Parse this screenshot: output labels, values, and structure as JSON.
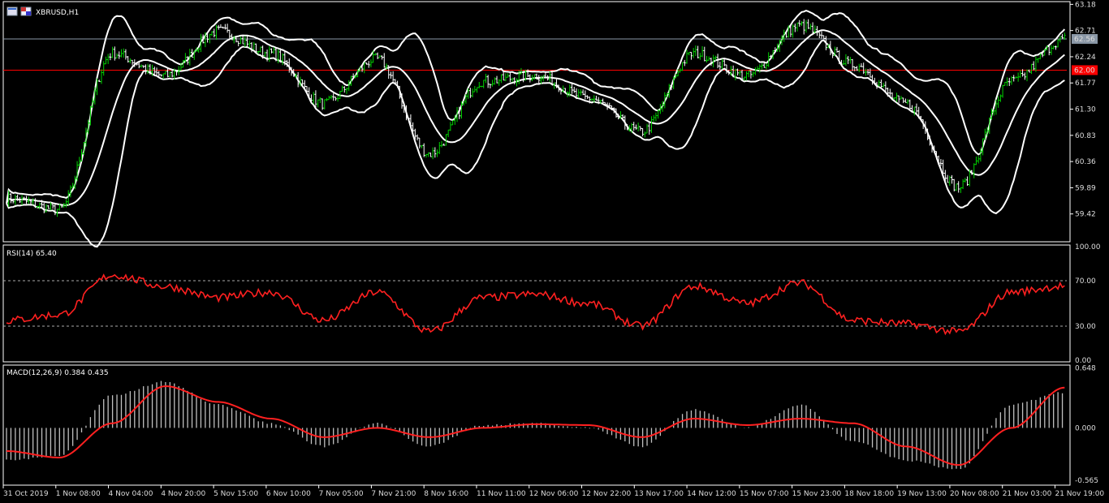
{
  "window": {
    "symbol_label": "XBRUSD,H1",
    "icon_names": [
      "chart-window-icon",
      "symbol-flag-icon"
    ]
  },
  "colors": {
    "background": "#000000",
    "bull_candle": "#00d000",
    "bear_candle": "#ffffff",
    "bands": "#ffffff",
    "rsi_line": "#ff2020",
    "macd_signal": "#ff2020",
    "macd_hist": "#c0c0c0",
    "level_line": "#ff0000",
    "bid_line": "#8a97a6"
  },
  "main": {
    "price_ticks": [
      "63.18",
      "62.71",
      "62.24",
      "61.77",
      "61.30",
      "60.83",
      "60.36",
      "59.89",
      "59.42"
    ],
    "current_price": "62.56",
    "level_price": "62.00",
    "ylim": [
      58.95,
      63.2
    ]
  },
  "rsi": {
    "label": "RSI(14) 65.40",
    "ticks": [
      "100.00",
      "70.00",
      "30.00",
      "0.00"
    ],
    "levels": [
      70,
      30
    ],
    "ylim": [
      0,
      100
    ]
  },
  "macd": {
    "label": "MACD(12,26,9) 0.384 0.435",
    "ticks": [
      "0.648",
      "0.000",
      "-0.565"
    ],
    "ylim": [
      -0.6,
      0.66
    ]
  },
  "time_axis": [
    "31 Oct 2019",
    "1 Nov 08:00",
    "4 Nov 04:00",
    "4 Nov 20:00",
    "5 Nov 15:00",
    "6 Nov 10:00",
    "7 Nov 05:00",
    "7 Nov 21:00",
    "8 Nov 16:00",
    "11 Nov 11:00",
    "12 Nov 06:00",
    "12 Nov 22:00",
    "13 Nov 17:00",
    "14 Nov 12:00",
    "15 Nov 07:00",
    "15 Nov 23:00",
    "18 Nov 18:00",
    "19 Nov 13:00",
    "20 Nov 08:00",
    "21 Nov 03:00",
    "21 Nov 19:00"
  ],
  "chart_data": {
    "type": "line",
    "x_points": [
      "31 Oct 2019",
      "1 Nov 08:00",
      "4 Nov 04:00",
      "4 Nov 20:00",
      "5 Nov 15:00",
      "6 Nov 10:00",
      "7 Nov 05:00",
      "7 Nov 21:00",
      "8 Nov 16:00",
      "11 Nov 11:00",
      "12 Nov 06:00",
      "12 Nov 22:00",
      "13 Nov 17:00",
      "14 Nov 12:00",
      "15 Nov 07:00",
      "15 Nov 23:00",
      "18 Nov 18:00",
      "19 Nov 13:00",
      "20 Nov 08:00",
      "21 Nov 03:00",
      "21 Nov 19:00"
    ],
    "series": [
      {
        "values": [
          59.7,
          59.5,
          62.3,
          61.9,
          62.7,
          62.3,
          61.4,
          62.2,
          60.5,
          61.8,
          61.9,
          61.5,
          60.9,
          62.3,
          61.9,
          62.8,
          62.1,
          61.4,
          59.9,
          61.8,
          62.56
        ]
      },
      {
        "values": [
          35,
          40,
          75,
          65,
          55,
          60,
          35,
          60,
          25,
          55,
          58,
          50,
          30,
          65,
          50,
          68,
          35,
          32,
          25,
          60,
          65.4
        ]
      },
      {
        "values": [
          -0.35,
          -0.3,
          0.35,
          0.5,
          0.25,
          0.05,
          -0.2,
          0.05,
          -0.2,
          0.03,
          0.05,
          0.0,
          -0.2,
          0.2,
          0.0,
          0.25,
          -0.15,
          -0.35,
          -0.45,
          0.25,
          0.384
        ]
      },
      {
        "values": [
          -0.25,
          -0.32,
          0.05,
          0.45,
          0.28,
          0.1,
          -0.1,
          0.0,
          -0.1,
          0.0,
          0.04,
          0.03,
          -0.1,
          0.1,
          0.03,
          0.1,
          0.05,
          -0.2,
          -0.4,
          0.0,
          0.435
        ]
      }
    ]
  }
}
